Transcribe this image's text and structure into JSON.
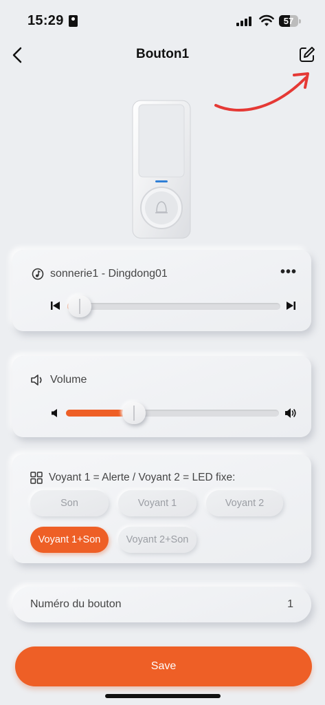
{
  "status_bar": {
    "time": "15:29",
    "battery": "57",
    "battery_fraction": 0.57,
    "icons": [
      "id-card-icon",
      "signal-icon",
      "wifi-icon",
      "battery-icon"
    ]
  },
  "nav": {
    "title": "Bouton1",
    "back_icon": "chevron-left-icon",
    "edit_icon": "edit-icon"
  },
  "annotation": {
    "color": "#e53935"
  },
  "ringtone": {
    "icon": "music-note-icon",
    "label": "sonnerie1 - Dingdong01",
    "more": "•••",
    "progress": 0.02
  },
  "volume": {
    "icon": "speaker-icon",
    "label": "Volume",
    "level": 0.28
  },
  "led": {
    "icon": "grid-icon",
    "label": "Voyant 1 = Alerte / Voyant 2 = LED fixe:",
    "options": [
      "Son",
      "Voyant 1",
      "Voyant 2",
      "Voyant 1+Son",
      "Voyant 2+Son"
    ],
    "selected": "Voyant 1+Son"
  },
  "button_number": {
    "label": "Numéro du bouton",
    "value": "1"
  },
  "save_label": "Save",
  "colors": {
    "accent": "#ee5f26",
    "background": "#eceef1",
    "chip_text": "#9b9ea4"
  }
}
